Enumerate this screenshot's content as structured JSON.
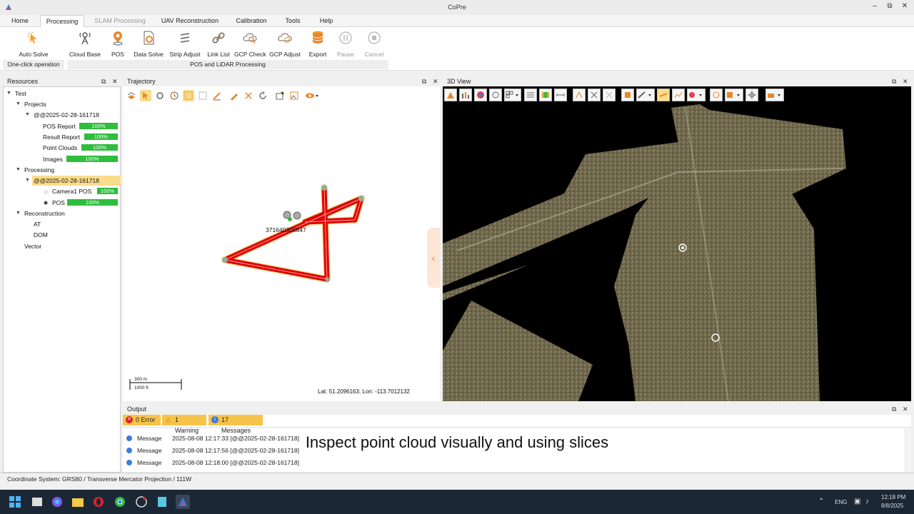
{
  "app": {
    "title": "CoPre",
    "min": "–",
    "max": "⧉",
    "close": "✕"
  },
  "menus": [
    {
      "label": "Home",
      "state": "normal"
    },
    {
      "label": "Processing",
      "state": "active"
    },
    {
      "label": "SLAM Processing",
      "state": "disabled"
    },
    {
      "label": "UAV Reconstruction",
      "state": "normal"
    },
    {
      "label": "Calibration",
      "state": "normal"
    },
    {
      "label": "Tools",
      "state": "normal"
    },
    {
      "label": "Help",
      "state": "normal"
    }
  ],
  "ribbon": {
    "buttons": [
      {
        "label": "Auto Solve",
        "icon": "auto-solve-icon",
        "disabled": false
      },
      {
        "label": "Cloud Base",
        "icon": "cloud-base-icon",
        "disabled": false
      },
      {
        "label": "POS",
        "icon": "pos-icon",
        "disabled": false
      },
      {
        "label": "Data Solve",
        "icon": "data-solve-icon",
        "disabled": false
      },
      {
        "label": "Strip Adjust",
        "icon": "strip-adjust-icon",
        "disabled": false
      },
      {
        "label": "Link List",
        "icon": "link-list-icon",
        "disabled": false
      },
      {
        "label": "GCP Check",
        "icon": "gcp-check-icon",
        "disabled": false
      },
      {
        "label": "GCP Adjust",
        "icon": "gcp-adjust-icon",
        "disabled": false
      },
      {
        "label": "Export",
        "icon": "export-icon",
        "disabled": false
      },
      {
        "label": "Pause",
        "icon": "pause-icon",
        "disabled": true
      },
      {
        "label": "Cancel",
        "icon": "cancel-icon",
        "disabled": true
      }
    ],
    "groups": [
      {
        "label": "One-click operation"
      },
      {
        "label": "POS and LiDAR Processing"
      }
    ]
  },
  "resources": {
    "title": "Resources",
    "tree": {
      "root": "Test",
      "projects": "Projects",
      "project": "@@2025-02-28-161718",
      "items": [
        {
          "label": "POS Report",
          "progress": "100%"
        },
        {
          "label": "Result Report",
          "progress": "100%"
        },
        {
          "label": "Point Clouds",
          "progress": "100%"
        },
        {
          "label": "Images",
          "progress": "100%"
        }
      ],
      "processing": "Processing",
      "proc_project": "@@2025-02-28-161718",
      "proc_items": [
        {
          "label": "Camera1 POS",
          "progress": "100%"
        },
        {
          "label": "POS",
          "progress": "100%"
        }
      ],
      "reconstruction": "Reconstruction",
      "recon_items": [
        "AT",
        "DOM"
      ],
      "vector": "Vector"
    }
  },
  "trajectory": {
    "title": "Trajectory",
    "point_label": "371640305847",
    "scale_m": "300 m",
    "scale_ft": "1000 ft",
    "coords": "Lat: 51.2096163; Lon: -113.7012132"
  },
  "view3d": {
    "title": "3D View"
  },
  "output": {
    "title": "Output",
    "errors": "0 Error",
    "warnings": "1 Warning",
    "messages": "17 Messages",
    "rows": [
      {
        "type": "Message",
        "text": "2025-08-08 12:17:33 [@@2025-02-28-161718]"
      },
      {
        "type": "Message",
        "text": "2025-08-08 12:17:56 [@@2025-02-28-161718]"
      },
      {
        "type": "Message",
        "text": "2025-08-08 12:18:00 [@@2025-02-28-161718]"
      }
    ]
  },
  "caption": "Inspect point cloud visually and using slices",
  "status": "Coordinate System: GRS80 / Transverse Mercator Projection / 111W",
  "taskbar": {
    "lang": "ENG",
    "time": "12:18 PM",
    "date": "8/8/2025"
  },
  "colors": {
    "accent": "#f7c44b",
    "progress": "#2ebd3c",
    "trajectory": "#e00000"
  }
}
